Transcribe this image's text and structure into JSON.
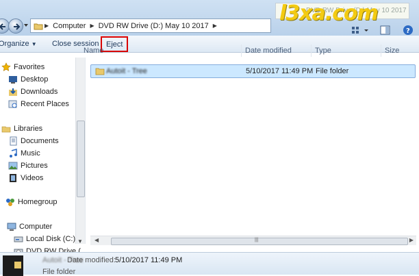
{
  "address": {
    "crumbs": [
      "Computer",
      "DVD RW Drive (D:) May 10 2017"
    ],
    "search_placeholder": "DVD RW Drive (D:) May 10 2017"
  },
  "watermark": "l3xa.com",
  "toolbar": {
    "organize": "Organize",
    "close_session": "Close session",
    "eject": "Eject"
  },
  "columns": {
    "name": "Name",
    "date_modified": "Date modified",
    "type": "Type",
    "size": "Size"
  },
  "nav": {
    "favorites": "Favorites",
    "desktop": "Desktop",
    "downloads": "Downloads",
    "recent_places": "Recent Places",
    "libraries": "Libraries",
    "documents": "Documents",
    "music": "Music",
    "pictures": "Pictures",
    "videos": "Videos",
    "homegroup": "Homegroup",
    "computer": "Computer",
    "local_disk": "Local Disk (C:)",
    "dvd_drive": "DVD RW Drive ("
  },
  "files": [
    {
      "name": "Autoit - Tree",
      "date": "5/10/2017 11:49 PM",
      "type": "File folder"
    }
  ],
  "details": {
    "name": "Autoit - Tree",
    "date_label": "Date modified:",
    "date_value": "5/10/2017 11:49 PM",
    "type": "File folder"
  },
  "colors": {
    "selection": "#cce8ff",
    "eject_highlight": "#d90000",
    "logo": "#f4c800"
  }
}
